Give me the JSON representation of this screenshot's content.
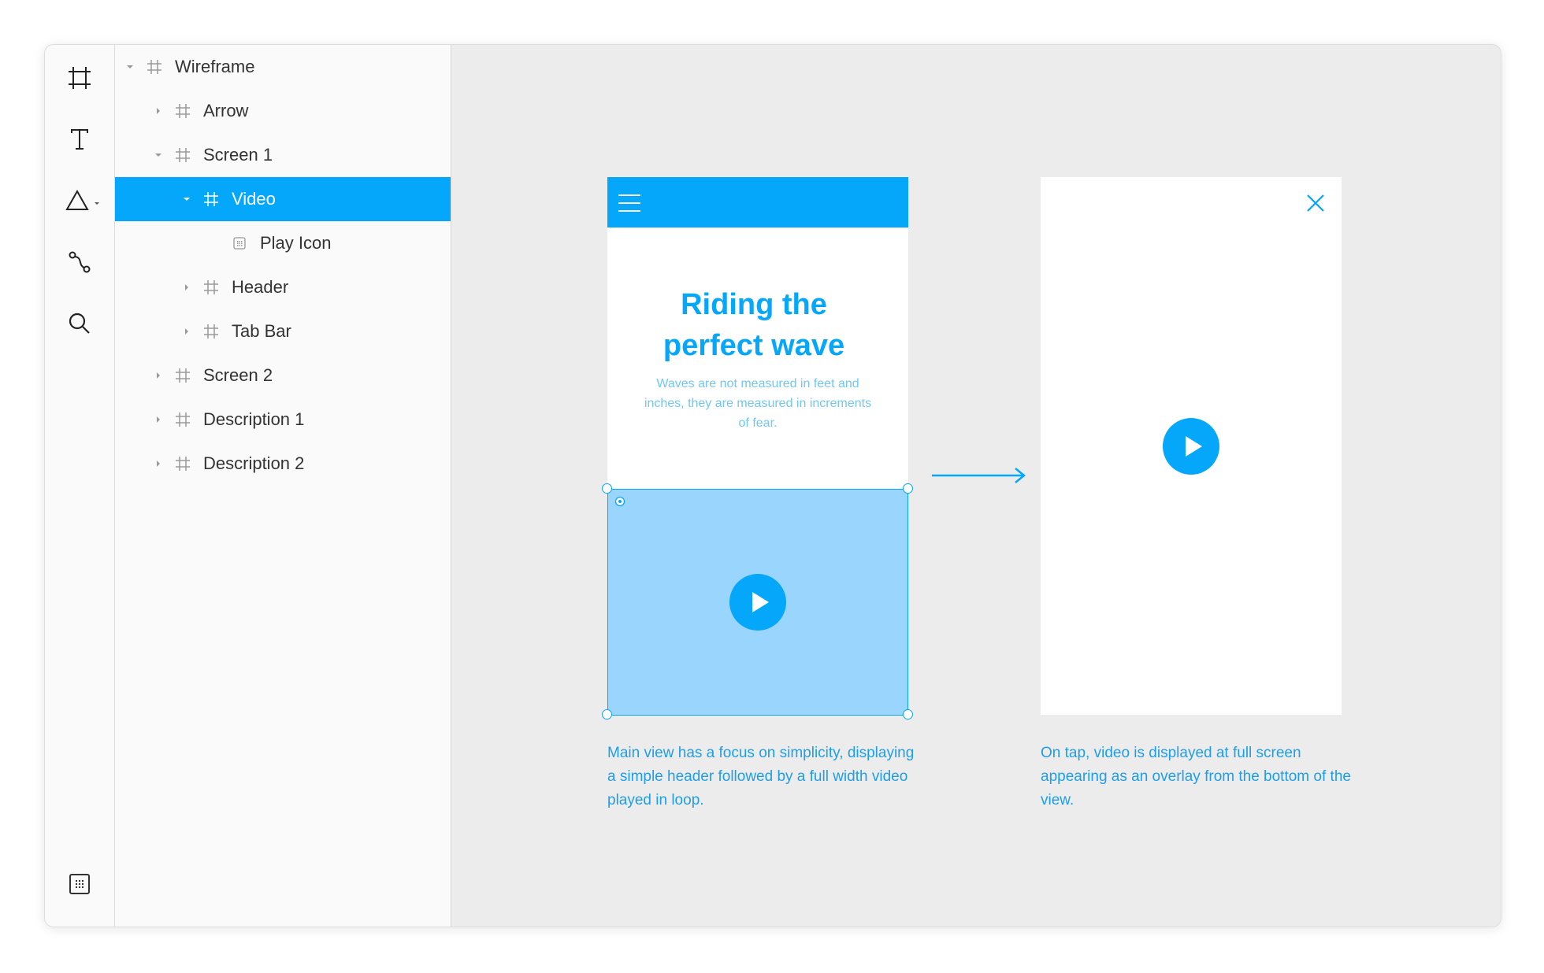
{
  "colors": {
    "accent": "#05a7fb",
    "video_fill": "#99d5fd",
    "canvas": "#ececec",
    "panel": "#fafafa"
  },
  "toolbar": {
    "tools": [
      "frame-icon",
      "text-icon",
      "shape-icon",
      "pen-icon",
      "search-icon"
    ],
    "bottom_tool": "grid-icon"
  },
  "layers": [
    {
      "label": "Wireframe",
      "depth": 0,
      "expanded": true,
      "type": "frame"
    },
    {
      "label": "Arrow",
      "depth": 1,
      "expanded": false,
      "type": "frame"
    },
    {
      "label": "Screen 1",
      "depth": 1,
      "expanded": true,
      "type": "frame"
    },
    {
      "label": "Video",
      "depth": 2,
      "expanded": true,
      "type": "frame",
      "selected": true
    },
    {
      "label": "Play Icon",
      "depth": 3,
      "type": "component"
    },
    {
      "label": "Header",
      "depth": 2,
      "expanded": false,
      "type": "frame"
    },
    {
      "label": "Tab Bar",
      "depth": 2,
      "expanded": false,
      "type": "frame"
    },
    {
      "label": "Screen 2",
      "depth": 1,
      "expanded": false,
      "type": "frame"
    },
    {
      "label": "Description 1",
      "depth": 1,
      "expanded": false,
      "type": "frame"
    },
    {
      "label": "Description 2",
      "depth": 1,
      "expanded": false,
      "type": "frame"
    }
  ],
  "screen1": {
    "title": "Riding the\nperfect wave",
    "subtitle": "Waves are not measured in feet and inches, they are measured in increments of fear."
  },
  "captions": {
    "left": "Main view has a focus on simplicity, displaying a simple header followed by a full width video played in loop.",
    "right": "On tap, video is displayed at full screen appearing as an overlay from the bottom of the view."
  }
}
